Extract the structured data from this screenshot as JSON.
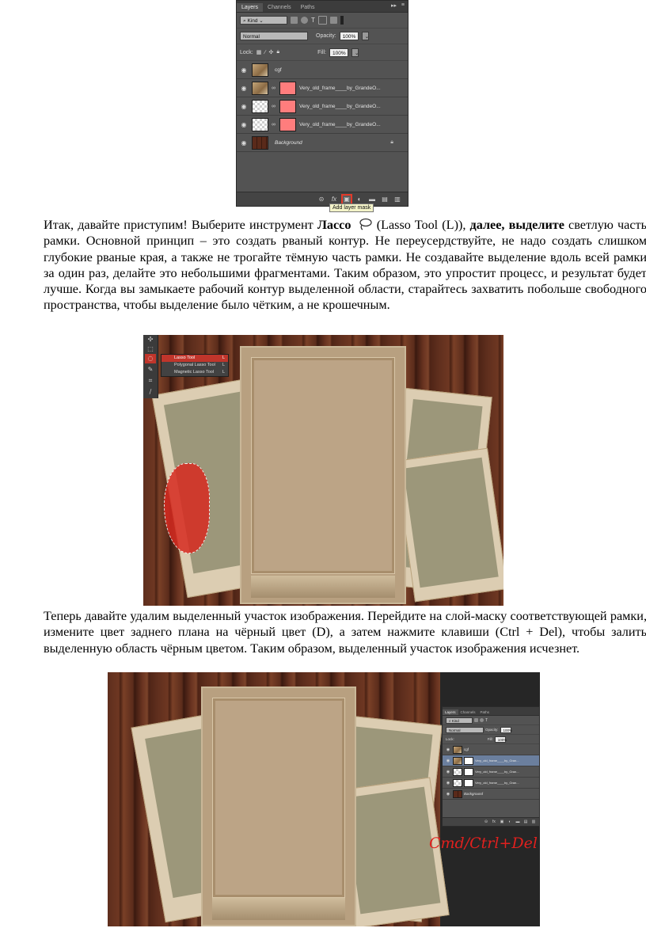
{
  "layers_panel": {
    "tabs": [
      "Layers",
      "Channels",
      "Paths"
    ],
    "filter_kind": "Kind",
    "blend_mode": "Normal",
    "opacity_label": "Opacity:",
    "opacity_value": "100%",
    "lock_label": "Lock:",
    "fill_label": "Fill:",
    "fill_value": "100%",
    "layers": [
      {
        "name": "cgf",
        "italic": false
      },
      {
        "name": "Very_old_frame____by_GrandeO...",
        "italic": false
      },
      {
        "name": "Very_old_frame____by_GrandeO...",
        "italic": false
      },
      {
        "name": "Very_old_frame____by_GrandeO...",
        "italic": false
      },
      {
        "name": "Background",
        "italic": true
      }
    ],
    "bottom_icons": [
      "link-icon",
      "fx-icon",
      "add-layer-mask-icon",
      "adjustment-icon",
      "folder-icon",
      "new-layer-icon",
      "trash-icon"
    ],
    "tooltip": "Add layer mask",
    "highlight_color": "#e23a2a"
  },
  "paragraph1": {
    "part1": "Итак, давайте приступим! Выберите инструмент ",
    "bold1": "Лассо",
    "part2": " (Lasso Tool (L)), ",
    "bold2": "далее, выделите",
    "part3": " светлую часть рамки. Основной принцип – это создать рваный контур. Не переусердствуйте, не надо создать слишком глубокие рваные края, а также не трогайте тёмную часть рамки. Не создавайте выделение вдоль всей рамки за один раз, делайте это небольшими фрагментами. Таким образом, это упростит процесс, и результат будет лучше. Когда вы замыкаете рабочий контур выделенной области, старайтесь захватить побольше свободного пространства, чтобы выделение было чётким, а не крошечным."
  },
  "tool_flyout": {
    "items": [
      {
        "label": "Lasso Tool",
        "key": "L"
      },
      {
        "label": "Polygonal Lasso Tool",
        "key": "L"
      },
      {
        "label": "Magnetic Lasso Tool",
        "key": "L"
      }
    ]
  },
  "paragraph2": {
    "text": "Теперь давайте удалим выделенный участок изображения. Перейдите на слой-маску соответствующей рамки, измените цвет заднего плана на чёрный цвет (D), а затем нажмите клавиши (Ctrl + Del), чтобы залить выделенную область чёрным цветом. Таким образом, выделенный участок изображения исчезнет."
  },
  "small_layers_panel": {
    "tabs": [
      "Layers",
      "Channels",
      "Paths"
    ],
    "filter_kind": "Kind",
    "blend_mode": "Normal",
    "opacity_label": "Opacity:",
    "opacity_value": "100%",
    "lock_label": "Lock:",
    "fill_label": "Fill:",
    "fill_value": "100%",
    "layers": [
      {
        "name": "cgf"
      },
      {
        "name": "Very_old_frame____by_Gran..."
      },
      {
        "name": "Very_old_frame____by_Gran..."
      },
      {
        "name": "Very_old_frame____by_Gran..."
      },
      {
        "name": "Background"
      }
    ]
  },
  "shortcut_text": "Cmd/Ctrl+Del",
  "colors": {
    "shortcut": "#e0201e",
    "selection": "#d72a20"
  }
}
